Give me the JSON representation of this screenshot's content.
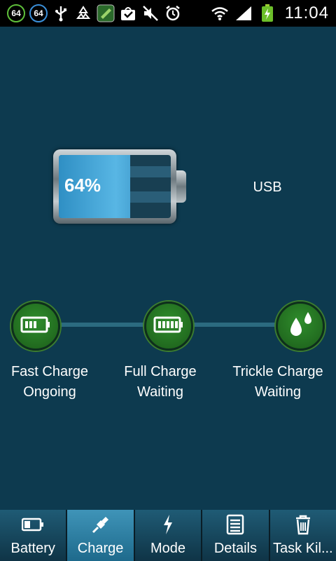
{
  "status_bar": {
    "badges": [
      "64",
      "64"
    ],
    "time": "11:04"
  },
  "battery": {
    "percent_text": "64%",
    "level": 0.64,
    "source": "USB"
  },
  "stages": [
    {
      "title": "Fast Charge",
      "status": "Ongoing",
      "icon": "battery-low-icon"
    },
    {
      "title": "Full Charge",
      "status": "Waiting",
      "icon": "battery-full-icon"
    },
    {
      "title": "Trickle Charge",
      "status": "Waiting",
      "icon": "droplets-icon"
    }
  ],
  "tabs": [
    {
      "label": "Battery",
      "icon": "battery-icon",
      "active": false
    },
    {
      "label": "Charge",
      "icon": "plug-icon",
      "active": true
    },
    {
      "label": "Mode",
      "icon": "lightning-icon",
      "active": false
    },
    {
      "label": "Details",
      "icon": "list-icon",
      "active": false
    },
    {
      "label": "Task Kil...",
      "icon": "trash-icon",
      "active": false
    }
  ],
  "colors": {
    "background": "#0d3a4f",
    "battery_fill": "#58b6e4",
    "stage_green": "#2f8d2c",
    "active_tab": "#3f94b8"
  }
}
